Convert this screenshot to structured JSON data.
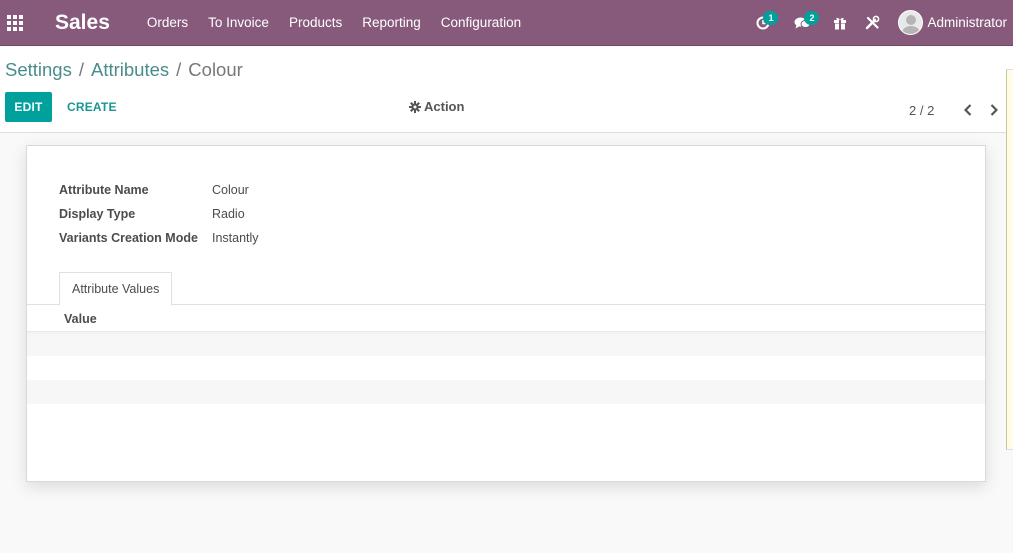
{
  "navbar": {
    "app_name": "Sales",
    "menu": [
      "Orders",
      "To Invoice",
      "Products",
      "Reporting",
      "Configuration"
    ],
    "activity_count": "1",
    "messages_count": "2",
    "user_name": "Administrator",
    "accent_color": "#875a7b"
  },
  "breadcrumb": {
    "items": [
      "Settings",
      "Attributes"
    ],
    "separator": "/",
    "current": "Colour"
  },
  "toolbar": {
    "edit_label": "EDIT",
    "create_label": "CREATE",
    "action_label": "Action",
    "pager_value": "2 / 2",
    "primary_color": "#00a09d"
  },
  "form": {
    "fields": [
      {
        "label": "Attribute Name",
        "value": "Colour"
      },
      {
        "label": "Display Type",
        "value": "Radio"
      },
      {
        "label": "Variants Creation Mode",
        "value": "Instantly"
      }
    ],
    "tab_label": "Attribute Values",
    "table": {
      "columns": [
        "Value"
      ],
      "rows": []
    }
  },
  "icons": {
    "apps": "apps-grid-icon",
    "activity": "clock-icon",
    "messages": "chat-icon",
    "gift": "gift-icon",
    "debug": "tools-icon",
    "action": "gear-icon",
    "prev": "chevron-left-icon",
    "next": "chevron-right-icon"
  }
}
